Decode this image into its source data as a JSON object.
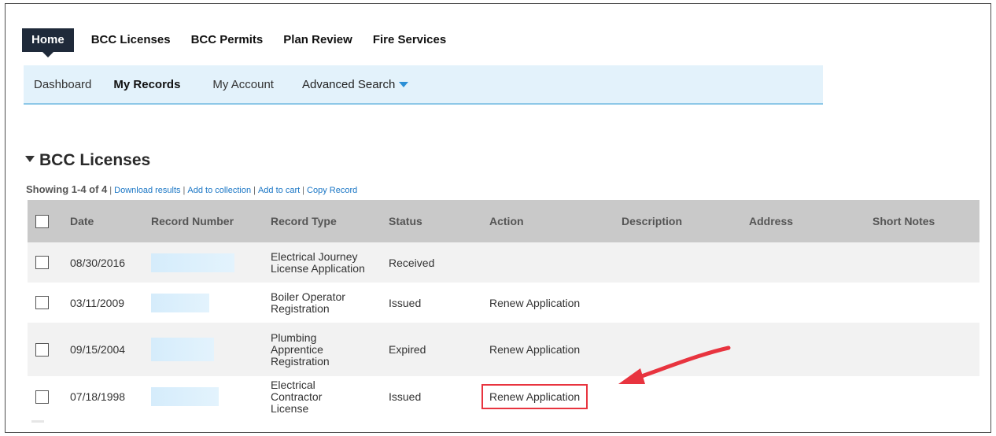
{
  "nav": {
    "tabs": [
      {
        "label": "Home",
        "active": true
      },
      {
        "label": "BCC Licenses"
      },
      {
        "label": "BCC Permits"
      },
      {
        "label": "Plan Review"
      },
      {
        "label": "Fire Services"
      }
    ]
  },
  "subnav": {
    "items": [
      "Dashboard",
      "My Records",
      "My Account",
      "Advanced Search"
    ]
  },
  "section": {
    "title": "BCC Licenses",
    "showing": "Showing 1-4 of 4",
    "links": [
      "Download results",
      "Add to collection",
      "Add to cart",
      "Copy Record"
    ]
  },
  "table": {
    "headers": [
      "Date",
      "Record Number",
      "Record Type",
      "Status",
      "Action",
      "Description",
      "Address",
      "Short Notes"
    ],
    "rows": [
      {
        "date": "08/30/2016",
        "type": "Electrical Journey License Application",
        "status": "Received",
        "action": ""
      },
      {
        "date": "03/11/2009",
        "type": "Boiler Operator Registration",
        "status": "Issued",
        "action": "Renew Application"
      },
      {
        "date": "09/15/2004",
        "type": "Plumbing Apprentice Registration",
        "status": "Expired",
        "action": "Renew Application"
      },
      {
        "date": "07/18/1998",
        "type": "Electrical Contractor License",
        "status": "Issued",
        "action": "Renew Application"
      }
    ]
  },
  "colors": {
    "nav_active_bg": "#1f2a3a",
    "subnav_bg": "#e3f2fb",
    "link": "#1a76c5",
    "highlight": "#e8343f"
  }
}
